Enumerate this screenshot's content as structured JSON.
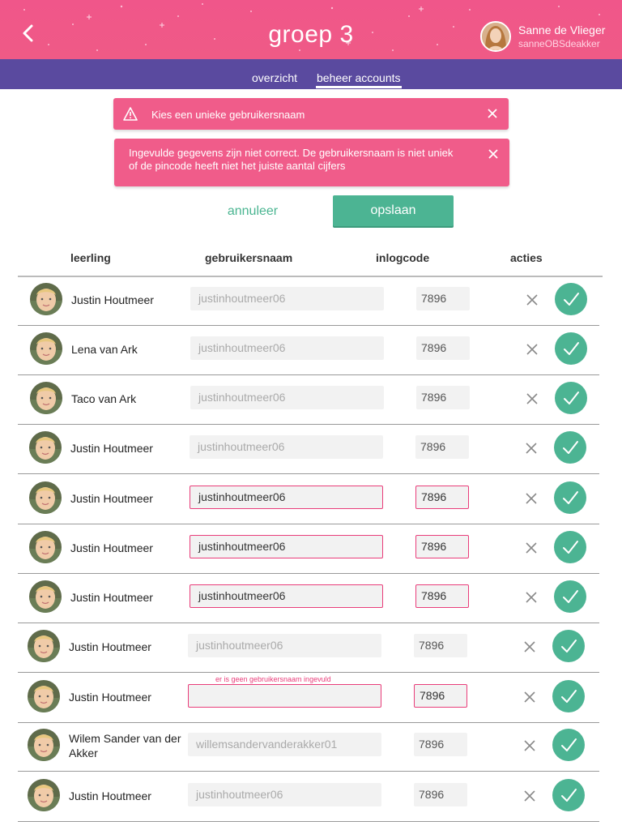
{
  "header": {
    "title": "groep 3",
    "user_name": "Sanne de Vlieger",
    "user_sub": "sanneOBSdeakker"
  },
  "tabs": [
    {
      "label": "overzicht",
      "active": false
    },
    {
      "label": "beheer accounts",
      "active": true
    }
  ],
  "alerts": [
    {
      "text": "Kies een unieke gebruikersnaam"
    },
    {
      "text": "Ingevulde gegevens zijn niet correct. De gebruikersnaam is niet uniek of de pincode heeft niet het juiste aantal cijfers"
    }
  ],
  "actions": {
    "cancel_label": "annuleer",
    "save_label": "opslaan"
  },
  "table": {
    "headers": [
      "leerling",
      "gebruikersnaam",
      "inlogcode",
      "acties"
    ],
    "rows": [
      {
        "name": "Justin Houtmeer",
        "username": "justinhoutmeer06",
        "code": "7896",
        "error": false
      },
      {
        "name": "Lena van Ark",
        "username": "justinhoutmeer06",
        "code": "7896",
        "error": false
      },
      {
        "name": "Taco van Ark",
        "username": "justinhoutmeer06",
        "code": "7896",
        "error": false
      },
      {
        "name": "Justin Houtmeer",
        "username": "justinhoutmeer06",
        "code": "7896",
        "error": false
      },
      {
        "name": "Justin Houtmeer",
        "username": "justinhoutmeer06",
        "code": "7896",
        "error": true
      },
      {
        "name": "Justin Houtmeer",
        "username": "justinhoutmeer06",
        "code": "7896",
        "error": true
      },
      {
        "name": "Justin Houtmeer",
        "username": "justinhoutmeer06",
        "code": "7896",
        "error": true
      },
      {
        "name": "Justin Houtmeer",
        "username": "justinhoutmeer06",
        "code": "7896",
        "error": false
      },
      {
        "name": "Justin Houtmeer",
        "username": "",
        "code": "7896",
        "error": true,
        "error_message": "er is geen gebruikersnaam ingevuld"
      },
      {
        "name": "Wilem Sander van der Akker",
        "username": "willemsandervanderakker01",
        "code": "7896",
        "error": false
      },
      {
        "name": "Justin Houtmeer",
        "username": "justinhoutmeer06",
        "code": "7896",
        "error": false
      }
    ]
  },
  "colors": {
    "header_pink": "#f0568a",
    "tab_purple": "#5a4a9f",
    "alert_pink": "#f05c8a",
    "accent_green": "#4cb493",
    "error_border": "#e93d7a"
  },
  "icons": [
    "chevron-left-icon",
    "warning-icon",
    "close-icon",
    "check-icon"
  ]
}
